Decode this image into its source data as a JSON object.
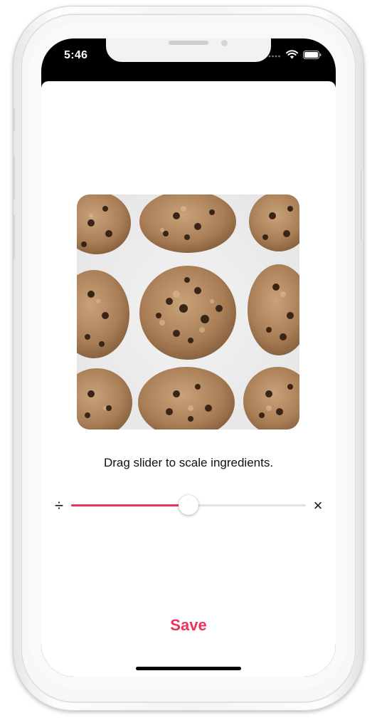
{
  "status_bar": {
    "time": "5:46",
    "icons": [
      "signal-dots-icon",
      "wifi-icon",
      "battery-icon"
    ]
  },
  "photo": {
    "subject": "cookie-photo"
  },
  "scale": {
    "caption": "Drag slider to scale ingredients.",
    "min_symbol": "÷",
    "max_symbol": "×",
    "value_fraction": 0.5
  },
  "actions": {
    "save_label": "Save"
  },
  "colors": {
    "accent": "#f0325a",
    "track": "#e2e2e2",
    "status_bar_bg": "#000000",
    "sheet_bg": "#ffffff"
  }
}
